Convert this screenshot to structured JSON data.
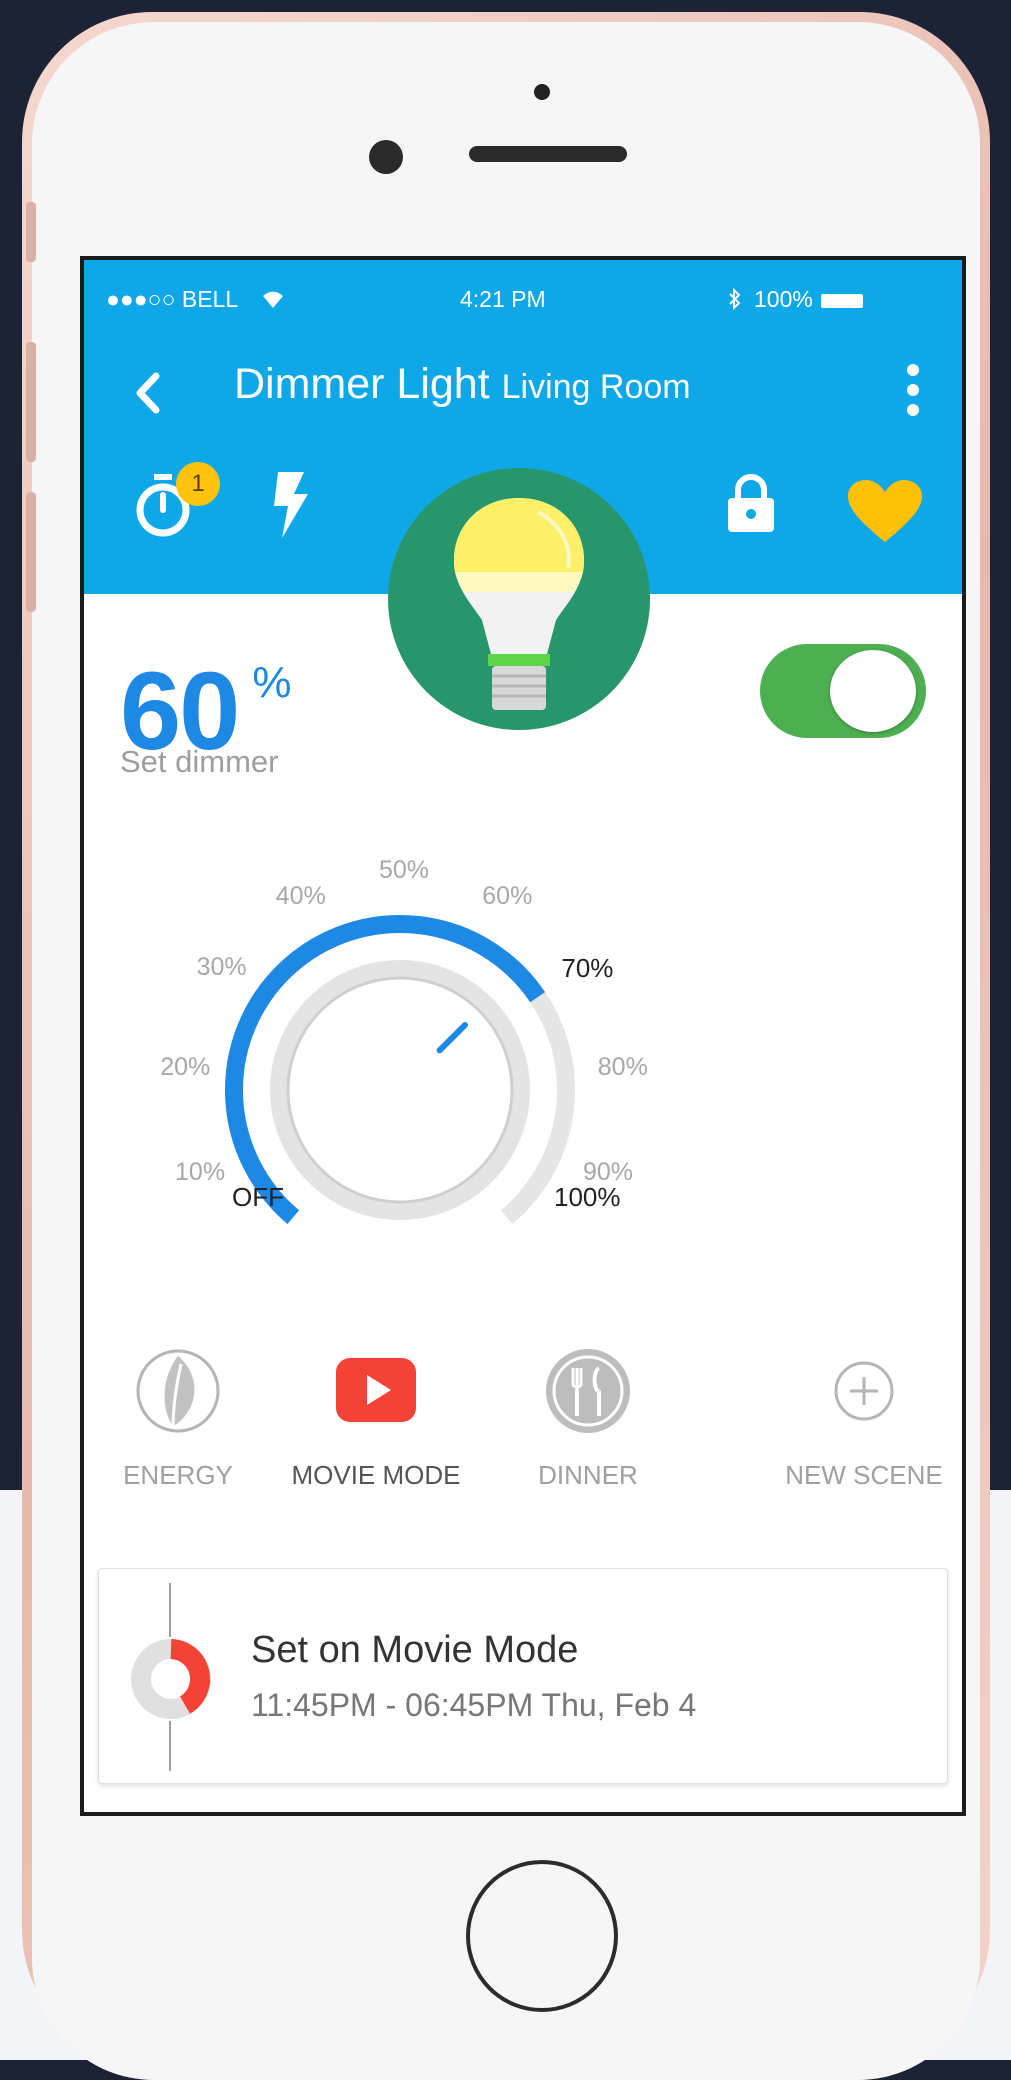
{
  "status_bar": {
    "carrier": "●●●○○ BELL",
    "time": "4:21 PM",
    "battery": "100%"
  },
  "header": {
    "title": "Dimmer Light",
    "subtitle": "Living Room",
    "timer_badge": "1"
  },
  "dimmer": {
    "value": "60",
    "unit": "%",
    "label": "Set dimmer",
    "level_fraction": 0.7,
    "power_on": true,
    "ticks": [
      "OFF",
      "10%",
      "20%",
      "30%",
      "40%",
      "50%",
      "60%",
      "70%",
      "80%",
      "90%",
      "100%"
    ]
  },
  "scenes": [
    {
      "label": "ENERGY",
      "icon": "leaf-icon",
      "active": false
    },
    {
      "label": "MOVIE MODE",
      "icon": "play-icon",
      "active": true
    },
    {
      "label": "DINNER",
      "icon": "dinner-icon",
      "active": false
    },
    {
      "label": "NEW SCENE",
      "icon": "plus-circle-icon",
      "active": false
    }
  ],
  "schedule": {
    "title": "Set on Movie Mode",
    "time": "11:45PM - 06:45PM Thu, Feb 4"
  },
  "colors": {
    "header": "#0ea7e8",
    "accent": "#1e88e5",
    "toggle_on": "#4caf50",
    "badge": "#ffc30f",
    "heart": "#ffc107",
    "movie_red": "#f44336"
  }
}
